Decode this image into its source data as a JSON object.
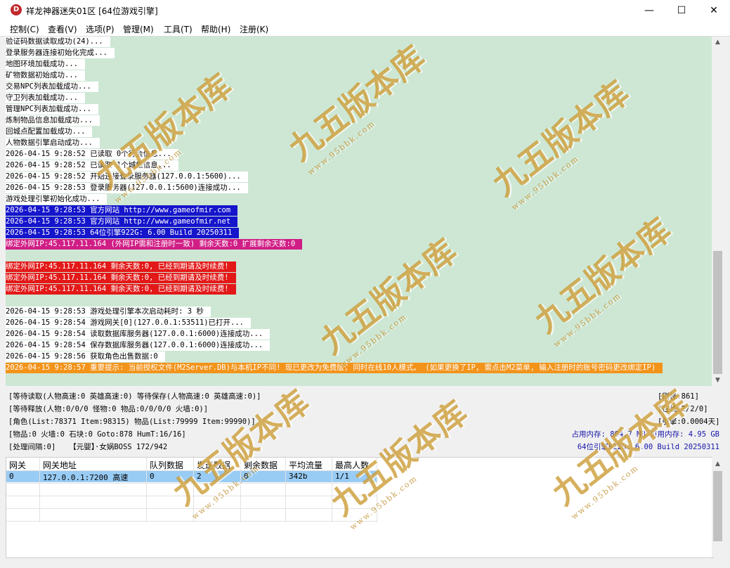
{
  "window": {
    "icon_letter": "D",
    "title": "祥龙神器迷失01区 [64位游戏引擎]",
    "minimize": "—",
    "maximize": "☐",
    "close": "✕"
  },
  "menu": [
    "控制(C)",
    "查看(V)",
    "选项(P)",
    "管理(M)",
    "工具(T)",
    "帮助(H)",
    "注册(K)"
  ],
  "log": [
    {
      "text": "验证码数据读取成功(24)...",
      "style": "plain"
    },
    {
      "text": "登录服务器连接初始化完成...",
      "style": "plain"
    },
    {
      "text": "地图环境加载成功...",
      "style": "plain"
    },
    {
      "text": "矿物数据初始成功...",
      "style": "plain"
    },
    {
      "text": "交易NPC列表加载成功...",
      "style": "plain"
    },
    {
      "text": "守卫列表加载成功...",
      "style": "plain"
    },
    {
      "text": "管理NPC列表加载成功...",
      "style": "plain"
    },
    {
      "text": "炼制物品信息加载成功...",
      "style": "plain"
    },
    {
      "text": "回城点配置加载成功...",
      "style": "plain"
    },
    {
      "text": "人物数据引擎启动成功...",
      "style": "plain"
    },
    {
      "text": "2026-04-15 9:28:52 已读取 0个行会信息...",
      "style": "plain"
    },
    {
      "text": "2026-04-15 9:28:52 已读取 1个城堡信息...",
      "style": "plain"
    },
    {
      "text": "2026-04-15 9:28:52 开始连接登录服务器(127.0.0.1:5600)...",
      "style": "plain"
    },
    {
      "text": "2026-04-15 9:28:53 登录服务器(127.0.0.1:5600)连接成功...",
      "style": "plain"
    },
    {
      "text": "游戏处理引擎初始化成功...",
      "style": "plain"
    },
    {
      "text": "2026-04-15 9:28:53 官方网站 http://www.gameofmir.com",
      "style": "blue"
    },
    {
      "text": "2026-04-15 9:28:53 官方网站 http://www.gameofmir.net",
      "style": "blue"
    },
    {
      "text": "2026-04-15 9:28:53 64位引擎922G: 6.00 Build 20250311",
      "style": "blue"
    },
    {
      "text": "绑定外网IP:45.117.11.164 (外网IP需和注册时一致) 剩余天数:0 扩展剩余天数:0",
      "style": "magenta"
    },
    {
      "text": "",
      "style": "none"
    },
    {
      "text": "绑定外网IP:45.117.11.164 剩余天数:0, 已经到期请及时续费!",
      "style": "red"
    },
    {
      "text": "绑定外网IP:45.117.11.164 剩余天数:0, 已经到期请及时续费!",
      "style": "red"
    },
    {
      "text": "绑定外网IP:45.117.11.164 剩余天数:0, 已经到期请及时续费!",
      "style": "red"
    },
    {
      "text": "",
      "style": "none"
    },
    {
      "text": "2026-04-15 9:28:53 游戏处理引擎本次启动耗时: 3 秒",
      "style": "plain"
    },
    {
      "text": "2026-04-15 9:28:54 游戏网关[0](127.0.0.1:53511)已打开...",
      "style": "plain"
    },
    {
      "text": "2026-04-15 9:28:54 读取数据库服务器(127.0.0.1:6000)连接成功...",
      "style": "plain"
    },
    {
      "text": "2026-04-15 9:28:54 保存数据库服务器(127.0.0.1:6000)连接成功...",
      "style": "plain"
    },
    {
      "text": "2026-04-15 9:28:56 获取角色出售数据:0",
      "style": "plain"
    },
    {
      "text": "2026-04-15 9:28:57 重要提示: 当前授权文件(M2Server.DB)与本机IP不同! 现已更改为免费版, 同时在线10人模式。 (如果更换了IP, 需点击M2菜单, 输入注册时的账号密码更改绑定IP)",
      "style": "orange"
    }
  ],
  "status": {
    "line1": "[等待读取(人物高速:0 英雄高速:0) 等待保存(人物高速:0 英雄高速:0)]",
    "line2": "[等待释放(人物:0/0/0 怪物:0 物品:0/0/0/0 火墙:0)]",
    "line3": "[角色(List:78371 Item:98315) 物品(List:79999 Item:99990)]",
    "line4": "[物品:0 火墙:0 石块:0 Goto:878 HumT:16/16]",
    "line5": "[处理间隔:0]   【元婴】·女娲BOSS 172/942",
    "refresh": "[刷怪:861]",
    "online": "[在线:2/2/0]",
    "engine": "[引擎:0.0004天]",
    "memory": "占用内存: 804.7 MB 可用内存: 4.95 GB",
    "version": "64位引擎922G: 6.00 Build 20250311"
  },
  "grid": {
    "headers": [
      "网关",
      "网关地址",
      "队列数据",
      "发送数据",
      "剩余数据",
      "平均流量",
      "最高人数"
    ],
    "rows": [
      [
        "0",
        "127.0.0.1:7200 高速",
        "0",
        "2",
        "0",
        "342b",
        "1/1"
      ]
    ]
  },
  "watermark": {
    "text": "九五版本库",
    "sub": "www.95bbk.com"
  },
  "colors": {
    "log_bg": "#cde7d4",
    "blue": "#1515cc",
    "magenta": "#d01e86",
    "red": "#e31818",
    "orange": "#f3931a",
    "selected_row": "#99ccf5"
  }
}
